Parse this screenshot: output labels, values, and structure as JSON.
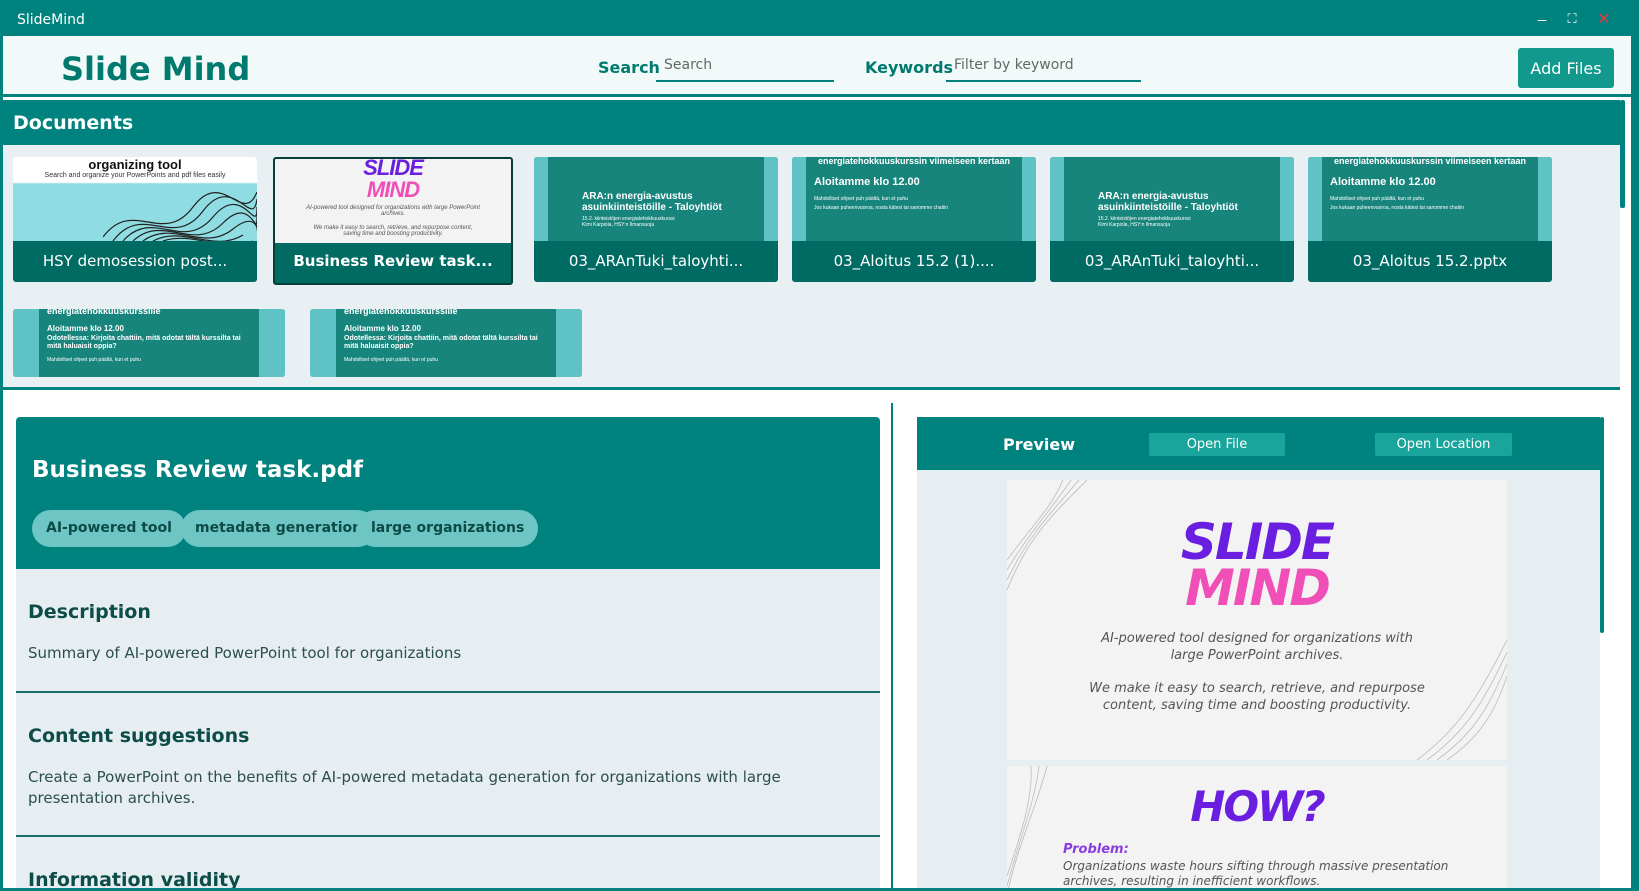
{
  "window": {
    "title": "SlideMind",
    "controls": {
      "minimize": "_",
      "maximize": "⛶",
      "close": "✕"
    }
  },
  "header": {
    "logo": "Slide Mind",
    "search_label": "Search",
    "search_placeholder": "Search",
    "keywords_label": "Keywords",
    "keywords_placeholder": "Filter by keyword",
    "add_files_label": "Add Files"
  },
  "documents": {
    "heading": "Documents",
    "cards": [
      {
        "label": "HSY demosession post...",
        "thumb_title": "organizing tool",
        "thumb_sub": "Search and organize your PowerPoints and pdf files easily"
      },
      {
        "label": "Business Review task...",
        "thumb_logo_1": "SLIDE",
        "thumb_logo_2": "MIND",
        "thumb_sub": "AI-powered tool designed for organizations with large PowerPoint archives.",
        "thumb_sub2": "We make it easy to search, retrieve, and repurpose content, saving time and boosting productivity."
      },
      {
        "label": "03_ARAnTuki_taloyhti...",
        "thumb_title": "ARA:n energia-avustus asuinkiinteistöille - Taloyhtiöt",
        "thumb_sub": "15.2. kiinteistöjen energiatehokkuuskurssi",
        "thumb_sub2": "Kimi Karpiola, HSY:n Ilmansuoja"
      },
      {
        "label": "03_Aloitus 15.2 (1)....",
        "thumb_top": "energiatehokkuuskurssin viimeiseen kertaan",
        "thumb_title": "Aloitamme klo 12.00",
        "thumb_sub": "Mahdolliset ohjeet puh päältä, kun et puhu",
        "thumb_sub2": "Jos kukaan puheenvuoroa, nosta kätesi tai sanomme chatiin"
      },
      {
        "label": "03_ARAnTuki_taloyhti...",
        "thumb_title": "ARA:n energia-avustus asuinkiinteistöille - Taloyhtiöt",
        "thumb_sub": "15.2. kiinteistöjen energiatehokkuuskurssi",
        "thumb_sub2": "Kimi Karpiola, HSY:n Ilmansuoja"
      },
      {
        "label": "03_Aloitus 15.2.pptx",
        "thumb_top": "energiatehokkuuskurssin viimeiseen kertaan",
        "thumb_title": "Aloitamme klo 12.00",
        "thumb_sub": "Mahdolliset ohjeet puh päältä, kun et puhu",
        "thumb_sub2": "Jos kukaan puheenvuoroa, nosta kätesi tai sanomme chatiin"
      },
      {
        "thumb_top": "energiatehokkuuskurssille",
        "thumb_title": "Aloitamme klo 12.00",
        "thumb_sub": "Odotellessa: Kirjoita chattiin, mitä odotat tältä kurssilta tai mitä haluaisit oppia?",
        "thumb_sub2": "Mahdolliset ohjeet puh päältä, kun et puhu"
      },
      {
        "thumb_top": "energiatehokkuuskurssille",
        "thumb_title": "Aloitamme klo 12.00",
        "thumb_sub": "Odotellessa: Kirjoita chattiin, mitä odotat tältä kurssilta tai mitä haluaisit oppia?",
        "thumb_sub2": "Mahdolliset ohjeet puh päältä, kun et puhu"
      }
    ]
  },
  "detail": {
    "title": "Business Review task.pdf",
    "tags": [
      "AI-powered tool",
      "metadata generation",
      "large organizations"
    ],
    "description_heading": "Description",
    "description": "Summary of AI-powered PowerPoint tool for organizations",
    "suggestions_heading": "Content suggestions",
    "suggestions": "Create a PowerPoint on the benefits of AI-powered metadata generation for organizations with large presentation archives.",
    "validity_heading": "Information validity"
  },
  "preview": {
    "title": "Preview",
    "open_file_label": "Open File",
    "open_location_label": "Open Location",
    "slide1": {
      "logo_1": "SLIDE",
      "logo_2": "MIND",
      "line1": "AI-powered tool designed for organizations with",
      "line2": "large PowerPoint archives.",
      "line3": "We make it easy to search, retrieve, and repurpose",
      "line4": "content, saving time and boosting productivity."
    },
    "slide2": {
      "heading": "HOW?",
      "problem_label": "Problem:",
      "problem_1": "Organizations waste hours sifting through massive presentation",
      "problem_2": "archives, resulting in inefficient workflows."
    }
  },
  "colors": {
    "accent": "#00827f",
    "logo_purple": "#6a1fe0",
    "logo_pink": "#f04fb8"
  }
}
